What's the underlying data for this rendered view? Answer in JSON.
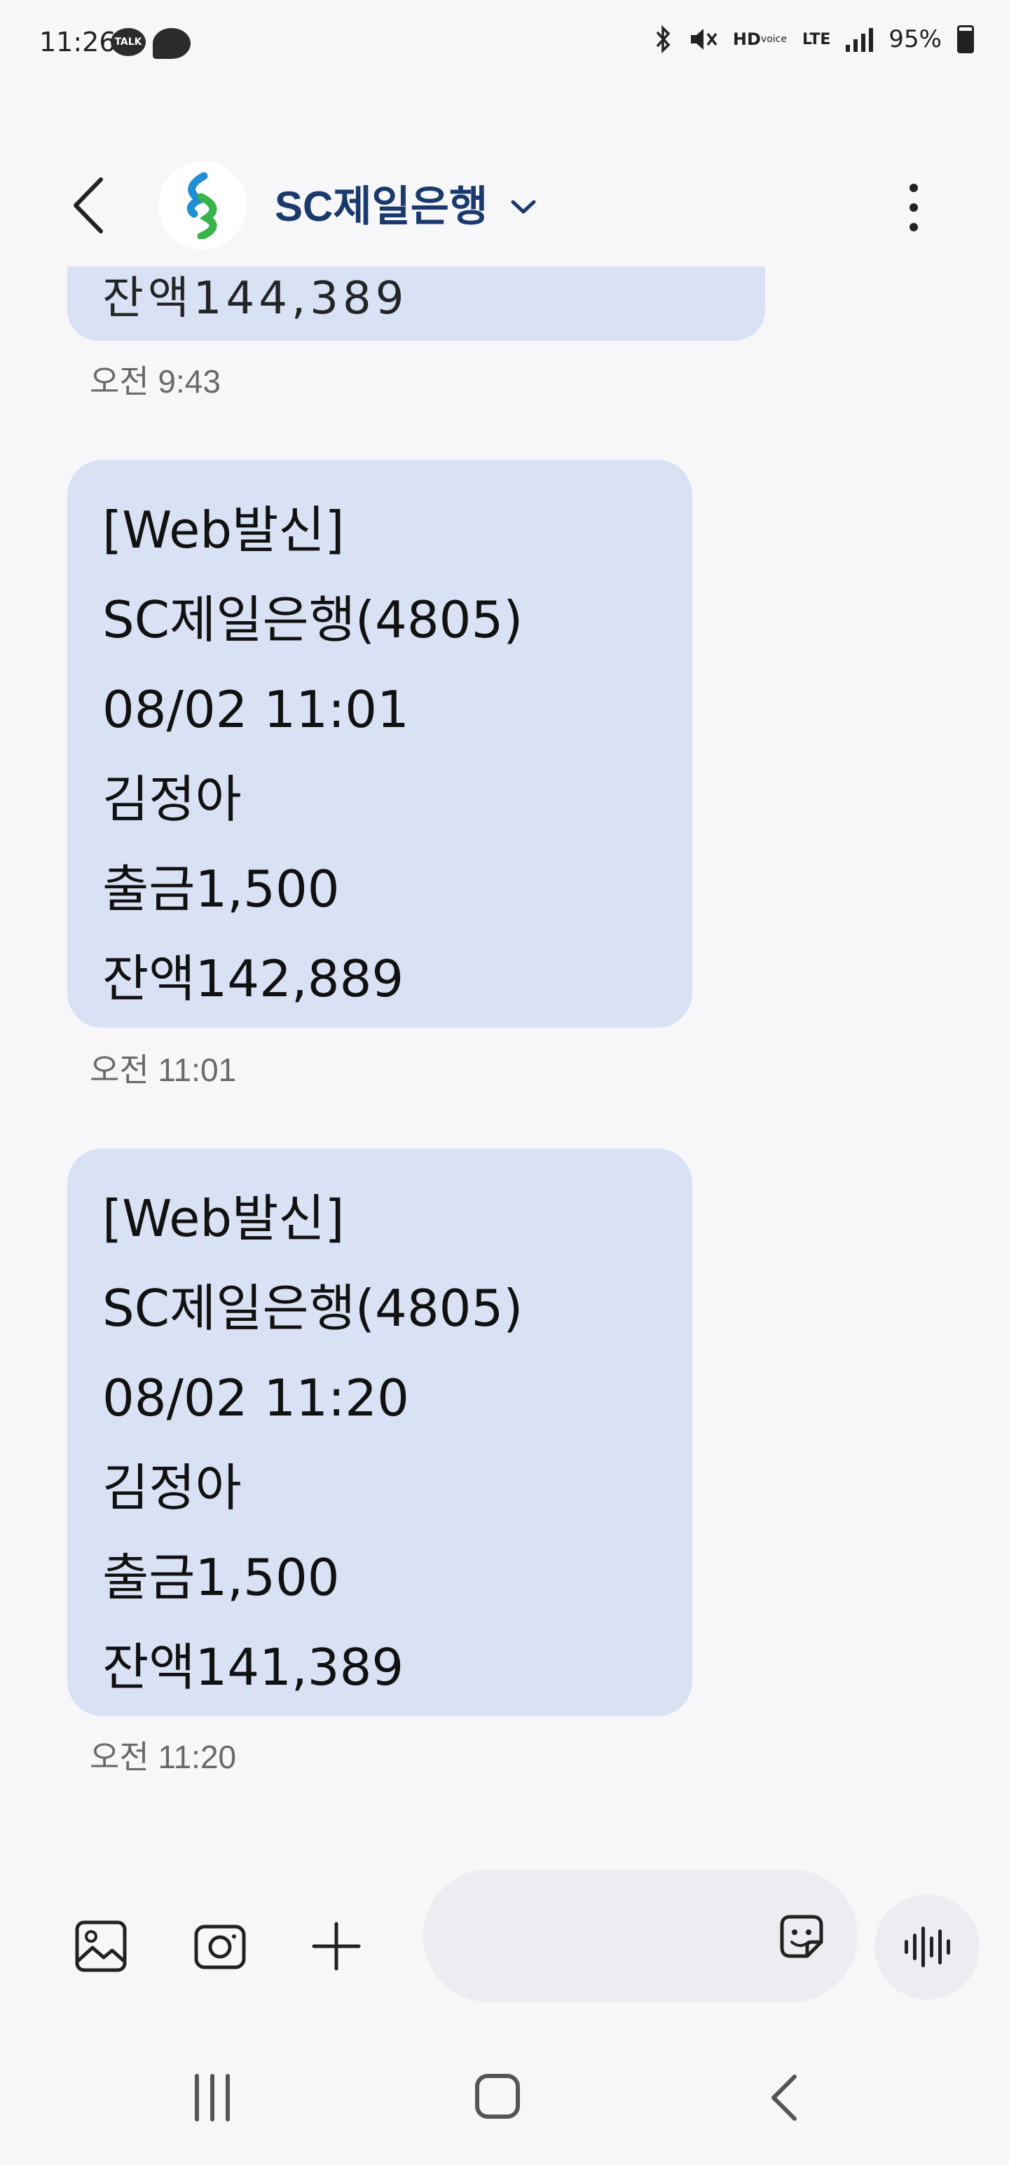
{
  "status_bar": {
    "time": "11:26",
    "talk_badge": "TALK",
    "hd": "HD",
    "voice": "voice",
    "lte": "LTE",
    "battery": "95%"
  },
  "header": {
    "title": "SC제일은행",
    "avatar_icon": "standard-chartered-logo"
  },
  "messages": {
    "previous_partial": "잔액144,389",
    "previous_time": "오전 9:43",
    "items": [
      {
        "lines": [
          "[Web발신]",
          "SC제일은행(4805)",
          "08/02 11:01",
          "김정아",
          "출금1,500",
          "잔액142,889"
        ],
        "time": "오전 11:01"
      },
      {
        "lines": [
          "[Web발신]",
          "SC제일은행(4805)",
          "08/02 11:20",
          "김정아",
          "출금1,500",
          "잔액141,389"
        ],
        "time": "오전 11:20"
      }
    ]
  },
  "composer": {
    "placeholder": "",
    "icons": [
      "gallery-icon",
      "camera-icon",
      "plus-icon",
      "emoji-icon",
      "voice-icon"
    ]
  },
  "colors": {
    "bubble": "#d9e1f5",
    "title": "#1a3a6e",
    "background": "#f7f7f9"
  }
}
